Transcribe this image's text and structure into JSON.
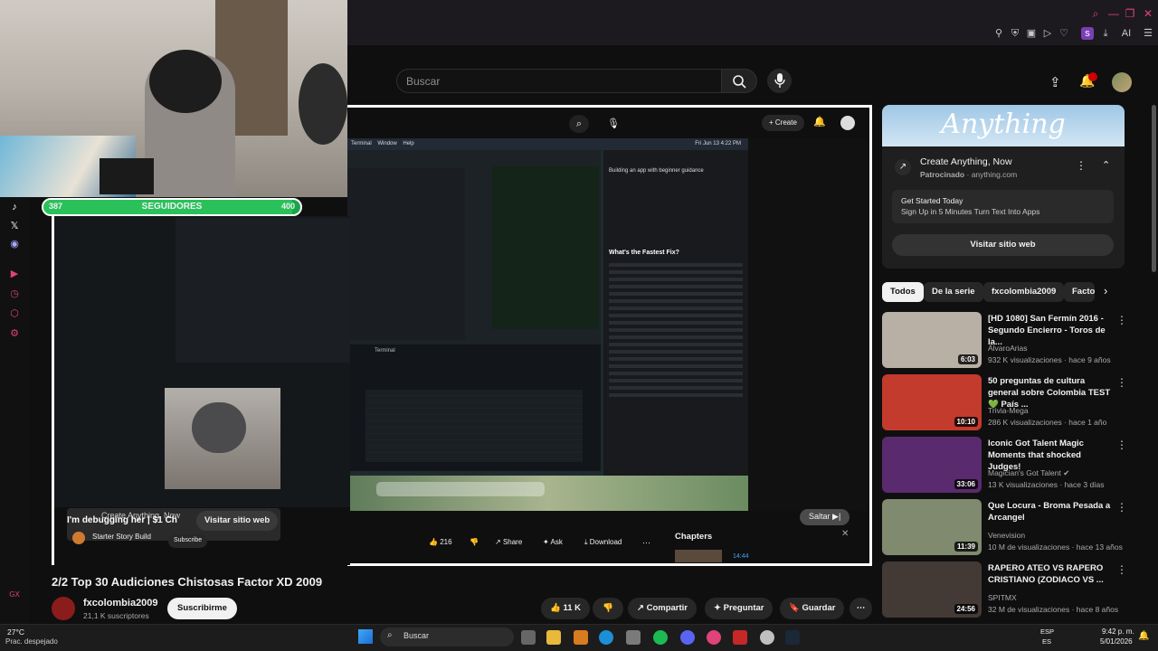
{
  "search": {
    "placeholder": "Buscar"
  },
  "follower_bar": {
    "label": "SEGUIDORES",
    "current": "387",
    "goal": "400",
    "progress": 0.9675
  },
  "video": {
    "title": "2/2 Top 30 Audiciones Chistosas Factor XD 2009",
    "inner_create": "+ Create",
    "skip": "Saltar",
    "chapters": "Chapters",
    "chapter_time": "14:44",
    "inner_likes": "216",
    "inner_share": "Share",
    "inner_ask": "Ask",
    "inner_download": "Download",
    "ad_text": "Create Anything, Now",
    "ad_line2": "I'm debugging her | $1 Ch",
    "ad_visit": "Visitar sitio web",
    "inner_channel": "Starter Story Build",
    "inner_subscribe": "Subscribe",
    "menu": [
      "Terminal",
      "Window",
      "Help"
    ],
    "menu_time": "Fri Jun 13 4:22 PM",
    "chat_heading": "What's the Fastest Fix?",
    "chat_sub": "Building an app with beginner guidance"
  },
  "channel": {
    "name": "fxcolombia2009",
    "subs": "21,1 K suscriptores",
    "subscribe": "Suscribirme"
  },
  "actions": {
    "likes": "11 K",
    "share": "Compartir",
    "ask": "Preguntar",
    "save": "Guardar"
  },
  "ad": {
    "logo": "Anything",
    "title": "Create Anything, Now",
    "sponsor": "Patrocinado",
    "domain": "anything.com",
    "cta_title": "Get Started Today",
    "cta_sub": "Sign Up in 5 Minutes Turn Text Into Apps",
    "visit": "Visitar sitio web"
  },
  "chips": [
    "Todos",
    "De la serie",
    "fxcolombia2009",
    "Facto"
  ],
  "recommendations": [
    {
      "title": "[HD 1080] San Fermín 2016 - Segundo Encierro - Toros de la...",
      "channel": "ÁlvaroArias",
      "meta": "932 K visualizaciones · hace 9 años",
      "duration": "6:03",
      "color": "#b8b0a4"
    },
    {
      "title": "50 preguntas de cultura general sobre Colombia TEST 💚 País ...",
      "channel": "Trivia-Mega",
      "meta": "286 K visualizaciones · hace 1 año",
      "duration": "10:10",
      "color": "#c33b2c"
    },
    {
      "title": "Iconic Got Talent Magic Moments that shocked Judges!",
      "channel": "Magician's Got Talent ✔",
      "meta": "13 K visualizaciones · hace 3 días",
      "duration": "33:06",
      "color": "#5a2a6e"
    },
    {
      "title": "Que Locura - Broma Pesada a Arcangel",
      "channel": "Venevision",
      "meta": "10 M de visualizaciones · hace 13 años",
      "duration": "11:39",
      "color": "#7f8a6e"
    },
    {
      "title": "RAPERO ATEO VS RAPERO CRISTIANO (ZODIACO VS ...",
      "channel": "SPITMX",
      "meta": "32 M de visualizaciones · hace 8 años",
      "duration": "24:56",
      "color": "#433a36"
    }
  ],
  "taskbar": {
    "weather": "27°C",
    "weather_desc": "Prac. despejado",
    "search": "Buscar",
    "lang": "ESP",
    "lang2": "ES",
    "time": "9:42 p. m.",
    "date": "5/01/2026"
  },
  "colors": {
    "accent": "#e0427a",
    "follower_green": "#2ac15b",
    "badge_red": "#cc0000"
  }
}
